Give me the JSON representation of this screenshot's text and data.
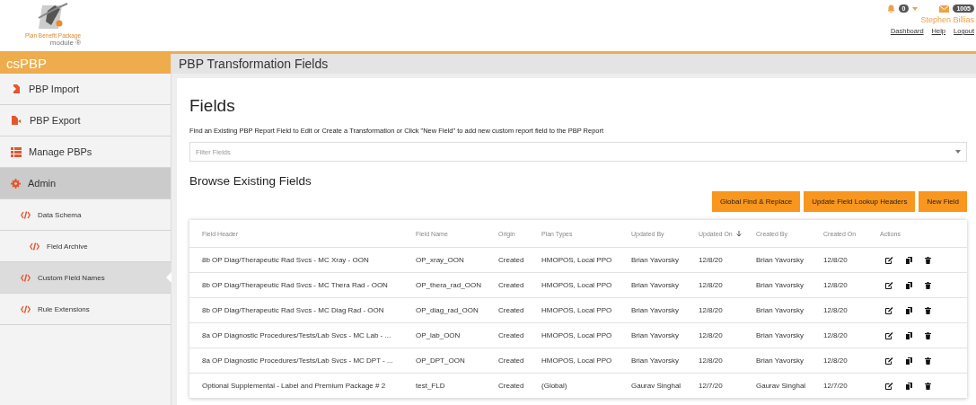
{
  "header": {
    "logo_text": "Plan Benefit Package",
    "logo_subtext": "module ®",
    "notifications": {
      "count": "0"
    },
    "messages": {
      "count": "1005"
    },
    "user_name": "Stephen Billias",
    "links": [
      "Dashboard",
      "Help",
      "Logout"
    ]
  },
  "sidebar": {
    "title": "csPBP",
    "items": [
      {
        "label": "PBP Import",
        "kind": "section",
        "selected": false
      },
      {
        "label": "PBP Export",
        "kind": "section",
        "selected": false
      },
      {
        "label": "Manage PBPs",
        "kind": "section",
        "selected": false
      },
      {
        "label": "Admin",
        "kind": "section",
        "selected": true
      },
      {
        "label": "Data Schema",
        "kind": "sub",
        "selected": false
      },
      {
        "label": "Field Archive",
        "kind": "subsub",
        "selected": false
      },
      {
        "label": "Custom Field Names",
        "kind": "sub",
        "selected": true
      },
      {
        "label": "Rule Extensions",
        "kind": "sub",
        "selected": false
      }
    ]
  },
  "page_title": "PBP Transformation Fields",
  "heading": "Fields",
  "description": "Find an Existing PBP Report Field to Edit or Create a Transformation or Click \"New Field\" to add new custom report field to the PBP Report",
  "filter": {
    "placeholder": "Filter Fields"
  },
  "subheading": "Browse Existing Fields",
  "buttons": [
    "Global Find & Replace",
    "Update Field Lookup Headers",
    "New Field"
  ],
  "table": {
    "columns": [
      {
        "label": "Field Header",
        "sorted": false
      },
      {
        "label": "Field Name",
        "sorted": false
      },
      {
        "label": "Origin",
        "sorted": false
      },
      {
        "label": "Plan Types",
        "sorted": false
      },
      {
        "label": "Updated By",
        "sorted": false
      },
      {
        "label": "Updated On",
        "sorted": true
      },
      {
        "label": "Created By",
        "sorted": false
      },
      {
        "label": "Created On",
        "sorted": false
      },
      {
        "label": "Actions",
        "sorted": false
      }
    ],
    "rows": [
      [
        "8b OP Diag/Therapeutic Rad Svcs - MC Xray - OON",
        "OP_xray_OON",
        "Created",
        "HMOPOS, Local PPO",
        "Brian Yavorsky",
        "12/8/20",
        "Brian Yavorsky",
        "12/8/20"
      ],
      [
        "8b OP Diag/Therapeutic Rad Svcs - MC Thera Rad - OON",
        "OP_thera_rad_OON",
        "Created",
        "HMOPOS, Local PPO",
        "Brian Yavorsky",
        "12/8/20",
        "Brian Yavorsky",
        "12/8/20"
      ],
      [
        "8b OP Diag/Therapeutic Rad Svcs - MC Diag Rad - OON",
        "OP_diag_rad_OON",
        "Created",
        "HMOPOS, Local PPO",
        "Brian Yavorsky",
        "12/8/20",
        "Brian Yavorsky",
        "12/8/20"
      ],
      [
        "8a OP Diagnostic Procedures/Tests/Lab Svcs - MC Lab - ...",
        "OP_lab_OON",
        "Created",
        "HMOPOS, Local PPO",
        "Brian Yavorsky",
        "12/8/20",
        "Brian Yavorsky",
        "12/8/20"
      ],
      [
        "8a OP Diagnostic Procedures/Tests/Lab Svcs - MC DPT - ...",
        "OP_DPT_OON",
        "Created",
        "HMOPOS, Local PPO",
        "Brian Yavorsky",
        "12/8/20",
        "Brian Yavorsky",
        "12/8/20"
      ],
      [
        "Optional Supplemental - Label and Premium Package # 2",
        "test_FLD",
        "Created",
        "(Global)",
        "Gaurav Singhal",
        "12/7/20",
        "Gaurav Singhal",
        "12/7/20"
      ]
    ]
  }
}
